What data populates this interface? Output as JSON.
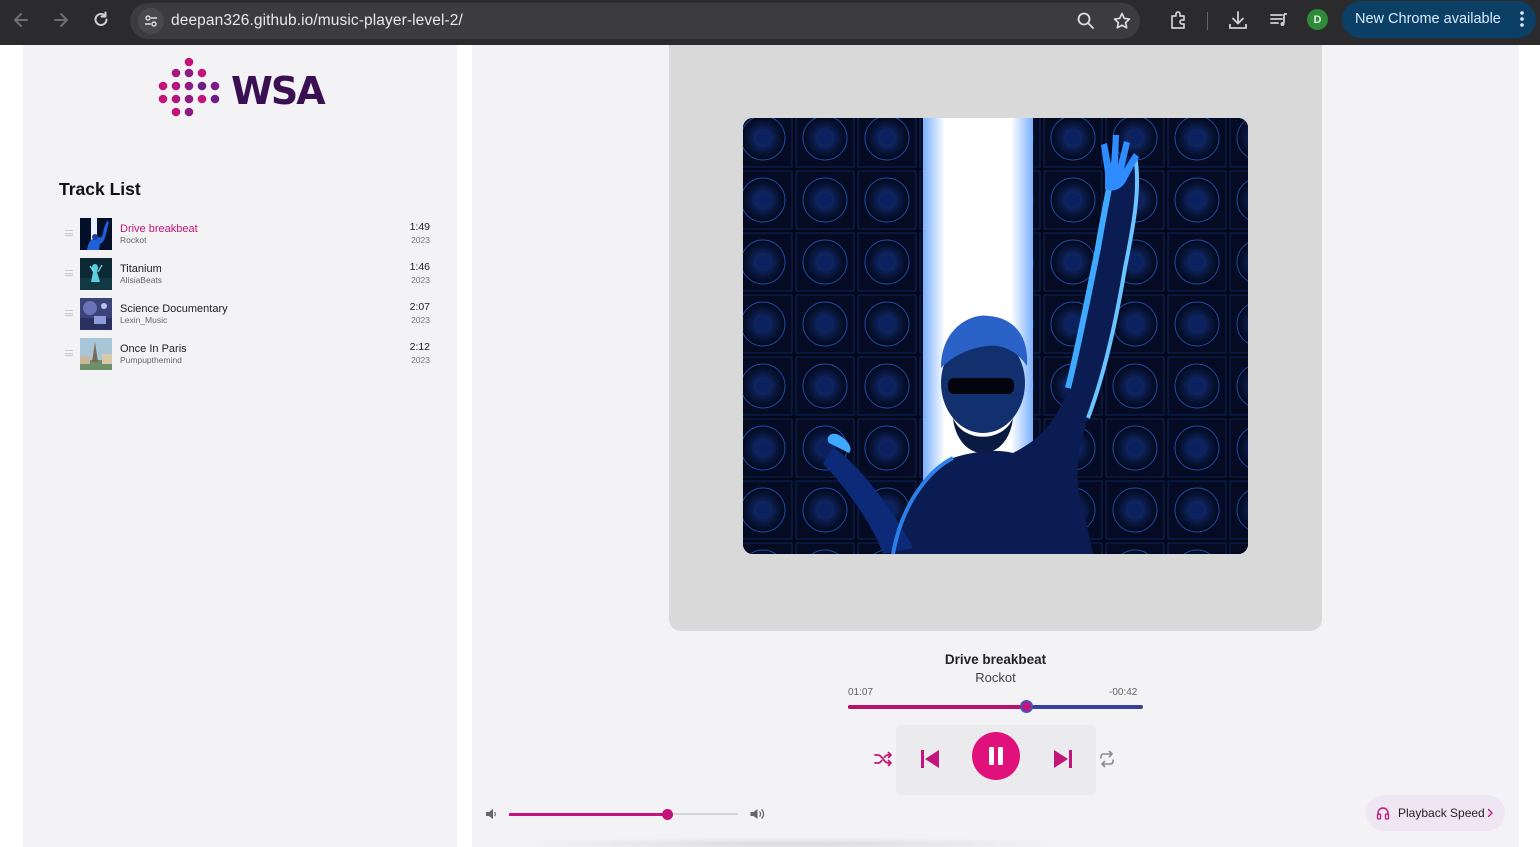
{
  "browser": {
    "url": "deepan326.github.io/music-player-level-2/",
    "update_label": "New Chrome available",
    "profile_initial": "D"
  },
  "sidebar": {
    "logo_text": "WSA",
    "heading": "Track List",
    "tracks": [
      {
        "title": "Drive breakbeat",
        "artist": "Rockot",
        "duration": "1:49",
        "year": "2023",
        "active": true
      },
      {
        "title": "Titanium",
        "artist": "AlisiaBeats",
        "duration": "1:46",
        "year": "2023",
        "active": false
      },
      {
        "title": "Science Documentary",
        "artist": "Lexin_Music",
        "duration": "2:07",
        "year": "2023",
        "active": false
      },
      {
        "title": "Once In Paris",
        "artist": "Pumpupthemind",
        "duration": "2:12",
        "year": "2023",
        "active": false
      }
    ]
  },
  "player": {
    "now_playing_title": "Drive breakbeat",
    "now_playing_artist": "Rockot",
    "time_elapsed": "01:07",
    "time_remaining": "-00:42",
    "progress_fraction": 0.605,
    "volume_fraction": 0.69,
    "is_playing": true,
    "playback_speed_label": "Playback Speed"
  },
  "colors": {
    "accent": "#e0117b",
    "accent_dark": "#c2147a",
    "seek_remaining": "#3a3f9a",
    "panel_bg": "#f3f2f4",
    "browser_bg": "#2b2b2d",
    "update_chip": "#0b3f66"
  },
  "icons": {
    "back": "arrow-left-icon",
    "forward": "arrow-right-icon",
    "reload": "reload-icon",
    "site_info": "tune-icon",
    "zoom": "zoom-icon",
    "bookmark": "star-icon",
    "extensions": "puzzle-icon",
    "downloads": "download-icon",
    "media": "queue-music-icon",
    "shuffle": "shuffle-icon",
    "previous": "skip-previous-icon",
    "pause": "pause-icon",
    "next": "skip-next-icon",
    "repeat": "repeat-icon",
    "volume_low": "volume-low-icon",
    "volume_high": "volume-high-icon",
    "headphones": "headphones-icon",
    "chevron": "chevron-right-icon"
  }
}
